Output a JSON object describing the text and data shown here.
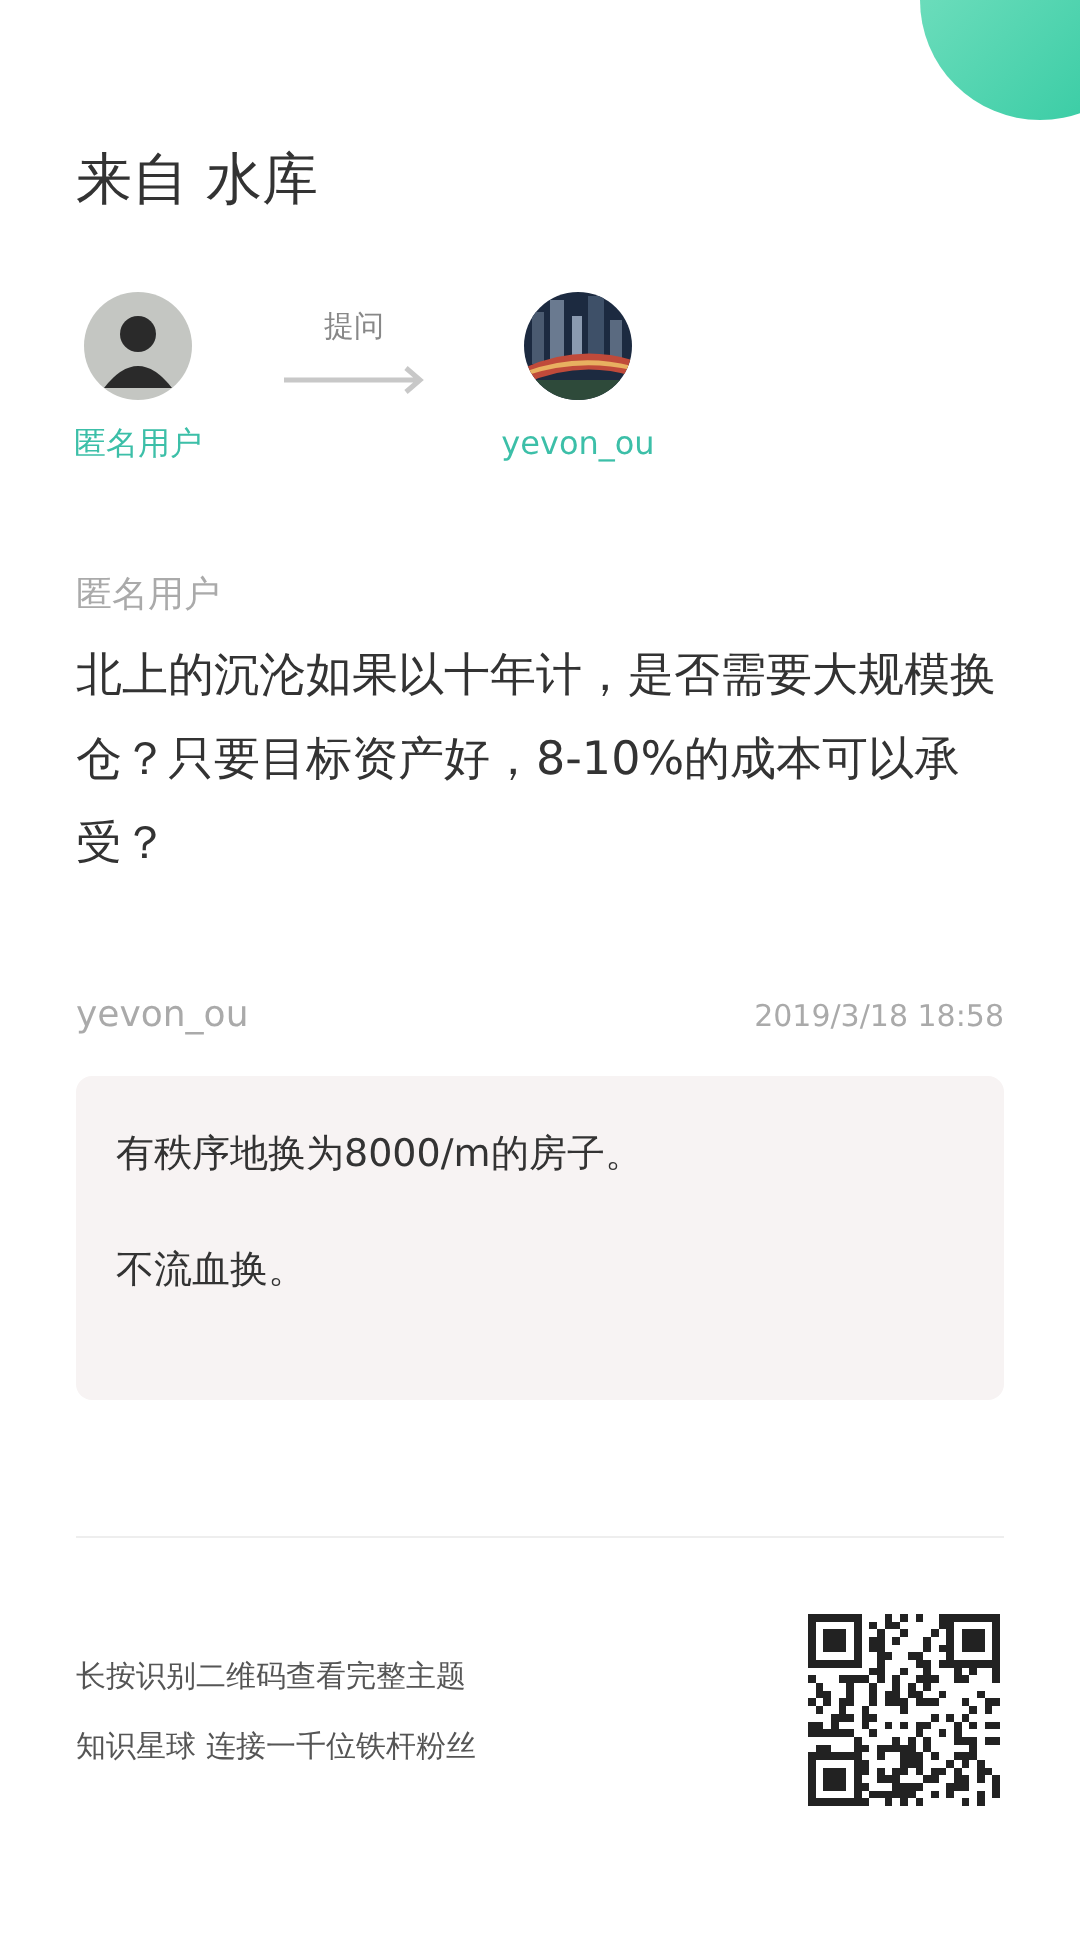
{
  "title": "来自 水库",
  "asker": {
    "name": "匿名用户"
  },
  "action": "提问",
  "answerer": {
    "name": "yevon_ou"
  },
  "question": {
    "author": "匿名用户",
    "text": "北上的沉沦如果以十年计，是否需要大规模换仓？只要目标资产好，8-10%的成本可以承受？"
  },
  "answer": {
    "author": "yevon_ou",
    "time": "2019/3/18 18:58",
    "paragraphs": [
      "有秩序地换为8000/m的房子。",
      "不流血换。"
    ]
  },
  "footer": {
    "lines": [
      "长按识别二维码查看完整主题",
      "知识星球 连接一千位铁杆粉丝"
    ]
  }
}
